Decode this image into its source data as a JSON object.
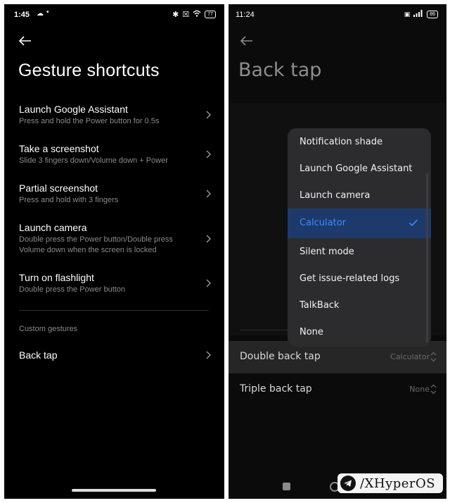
{
  "left": {
    "status": {
      "time": "1:45",
      "battery": "77"
    },
    "title": "Gesture shortcuts",
    "items": [
      {
        "label": "Launch Google Assistant",
        "sub": "Press and hold the Power button for 0.5s"
      },
      {
        "label": "Take a screenshot",
        "sub": "Slide 3 fingers down/Volume down + Power"
      },
      {
        "label": "Partial screenshot",
        "sub": "Press and hold with 3 fingers"
      },
      {
        "label": "Launch camera",
        "sub": "Double press the Power button/Double press Volume down when the screen is locked"
      },
      {
        "label": "Turn on flashlight",
        "sub": "Double press the Power button"
      }
    ],
    "section": "Custom gestures",
    "custom_item": {
      "label": "Back tap"
    }
  },
  "right": {
    "status": {
      "time": "11:24",
      "battery": "86"
    },
    "title": "Back tap",
    "menu": [
      "Notification shade",
      "Launch Google Assistant",
      "Launch camera",
      "Calculator",
      "Silent mode",
      "Get issue-related logs",
      "TalkBack",
      "None"
    ],
    "menu_selected": "Calculator",
    "rows": [
      {
        "label": "Double back tap",
        "value": "Calculator"
      },
      {
        "label": "Triple back tap",
        "value": "None"
      }
    ]
  },
  "watermark": {
    "text": "/XHyperOS"
  },
  "colors": {
    "accent": "#3d8aff",
    "selected_bg": "#1d3a6b",
    "menu_bg": "#2c2c2e"
  }
}
